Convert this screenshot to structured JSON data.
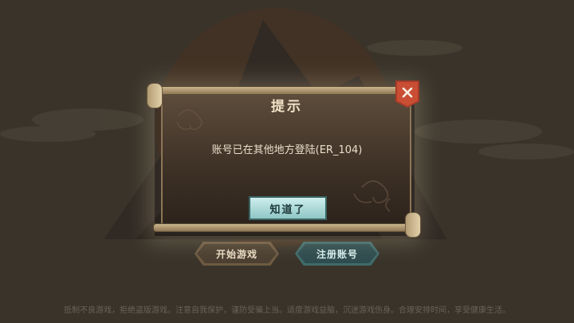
{
  "menu": {
    "start_label": "开始游戏",
    "register_label": "注册账号"
  },
  "footer": {
    "notice": "抵制不良游戏，拒绝盗版游戏。注意自我保护，谨防受骗上当。适度游戏益脑，沉迷游戏伤身。合理安排时间，享受健康生活。"
  },
  "dialog": {
    "title": "提示",
    "message": "账号已在其他地方登陆(ER_104)",
    "confirm_label": "知道了",
    "close_icon": "close-icon"
  },
  "colors": {
    "background": "#4a4238",
    "confirm_button": "#a9d9d8",
    "close_button": "#c94e34",
    "register_button": "#2e4b4f"
  }
}
